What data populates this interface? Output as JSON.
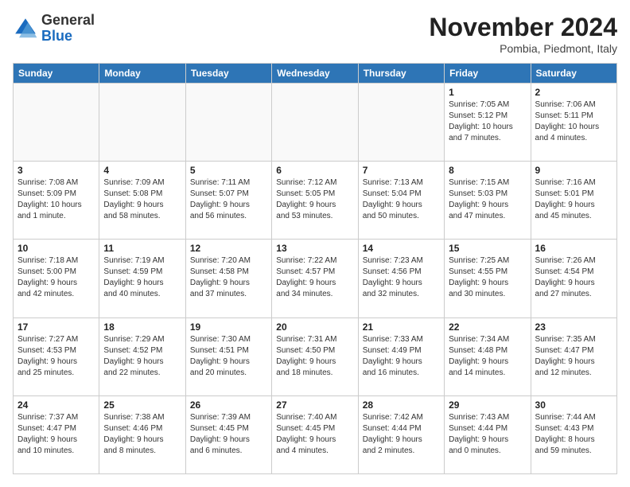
{
  "logo": {
    "general": "General",
    "blue": "Blue"
  },
  "header": {
    "month_year": "November 2024",
    "location": "Pombia, Piedmont, Italy"
  },
  "weekdays": [
    "Sunday",
    "Monday",
    "Tuesday",
    "Wednesday",
    "Thursday",
    "Friday",
    "Saturday"
  ],
  "weeks": [
    [
      {
        "day": "",
        "info": ""
      },
      {
        "day": "",
        "info": ""
      },
      {
        "day": "",
        "info": ""
      },
      {
        "day": "",
        "info": ""
      },
      {
        "day": "",
        "info": ""
      },
      {
        "day": "1",
        "info": "Sunrise: 7:05 AM\nSunset: 5:12 PM\nDaylight: 10 hours\nand 7 minutes."
      },
      {
        "day": "2",
        "info": "Sunrise: 7:06 AM\nSunset: 5:11 PM\nDaylight: 10 hours\nand 4 minutes."
      }
    ],
    [
      {
        "day": "3",
        "info": "Sunrise: 7:08 AM\nSunset: 5:09 PM\nDaylight: 10 hours\nand 1 minute."
      },
      {
        "day": "4",
        "info": "Sunrise: 7:09 AM\nSunset: 5:08 PM\nDaylight: 9 hours\nand 58 minutes."
      },
      {
        "day": "5",
        "info": "Sunrise: 7:11 AM\nSunset: 5:07 PM\nDaylight: 9 hours\nand 56 minutes."
      },
      {
        "day": "6",
        "info": "Sunrise: 7:12 AM\nSunset: 5:05 PM\nDaylight: 9 hours\nand 53 minutes."
      },
      {
        "day": "7",
        "info": "Sunrise: 7:13 AM\nSunset: 5:04 PM\nDaylight: 9 hours\nand 50 minutes."
      },
      {
        "day": "8",
        "info": "Sunrise: 7:15 AM\nSunset: 5:03 PM\nDaylight: 9 hours\nand 47 minutes."
      },
      {
        "day": "9",
        "info": "Sunrise: 7:16 AM\nSunset: 5:01 PM\nDaylight: 9 hours\nand 45 minutes."
      }
    ],
    [
      {
        "day": "10",
        "info": "Sunrise: 7:18 AM\nSunset: 5:00 PM\nDaylight: 9 hours\nand 42 minutes."
      },
      {
        "day": "11",
        "info": "Sunrise: 7:19 AM\nSunset: 4:59 PM\nDaylight: 9 hours\nand 40 minutes."
      },
      {
        "day": "12",
        "info": "Sunrise: 7:20 AM\nSunset: 4:58 PM\nDaylight: 9 hours\nand 37 minutes."
      },
      {
        "day": "13",
        "info": "Sunrise: 7:22 AM\nSunset: 4:57 PM\nDaylight: 9 hours\nand 34 minutes."
      },
      {
        "day": "14",
        "info": "Sunrise: 7:23 AM\nSunset: 4:56 PM\nDaylight: 9 hours\nand 32 minutes."
      },
      {
        "day": "15",
        "info": "Sunrise: 7:25 AM\nSunset: 4:55 PM\nDaylight: 9 hours\nand 30 minutes."
      },
      {
        "day": "16",
        "info": "Sunrise: 7:26 AM\nSunset: 4:54 PM\nDaylight: 9 hours\nand 27 minutes."
      }
    ],
    [
      {
        "day": "17",
        "info": "Sunrise: 7:27 AM\nSunset: 4:53 PM\nDaylight: 9 hours\nand 25 minutes."
      },
      {
        "day": "18",
        "info": "Sunrise: 7:29 AM\nSunset: 4:52 PM\nDaylight: 9 hours\nand 22 minutes."
      },
      {
        "day": "19",
        "info": "Sunrise: 7:30 AM\nSunset: 4:51 PM\nDaylight: 9 hours\nand 20 minutes."
      },
      {
        "day": "20",
        "info": "Sunrise: 7:31 AM\nSunset: 4:50 PM\nDaylight: 9 hours\nand 18 minutes."
      },
      {
        "day": "21",
        "info": "Sunrise: 7:33 AM\nSunset: 4:49 PM\nDaylight: 9 hours\nand 16 minutes."
      },
      {
        "day": "22",
        "info": "Sunrise: 7:34 AM\nSunset: 4:48 PM\nDaylight: 9 hours\nand 14 minutes."
      },
      {
        "day": "23",
        "info": "Sunrise: 7:35 AM\nSunset: 4:47 PM\nDaylight: 9 hours\nand 12 minutes."
      }
    ],
    [
      {
        "day": "24",
        "info": "Sunrise: 7:37 AM\nSunset: 4:47 PM\nDaylight: 9 hours\nand 10 minutes."
      },
      {
        "day": "25",
        "info": "Sunrise: 7:38 AM\nSunset: 4:46 PM\nDaylight: 9 hours\nand 8 minutes."
      },
      {
        "day": "26",
        "info": "Sunrise: 7:39 AM\nSunset: 4:45 PM\nDaylight: 9 hours\nand 6 minutes."
      },
      {
        "day": "27",
        "info": "Sunrise: 7:40 AM\nSunset: 4:45 PM\nDaylight: 9 hours\nand 4 minutes."
      },
      {
        "day": "28",
        "info": "Sunrise: 7:42 AM\nSunset: 4:44 PM\nDaylight: 9 hours\nand 2 minutes."
      },
      {
        "day": "29",
        "info": "Sunrise: 7:43 AM\nSunset: 4:44 PM\nDaylight: 9 hours\nand 0 minutes."
      },
      {
        "day": "30",
        "info": "Sunrise: 7:44 AM\nSunset: 4:43 PM\nDaylight: 8 hours\nand 59 minutes."
      }
    ]
  ]
}
